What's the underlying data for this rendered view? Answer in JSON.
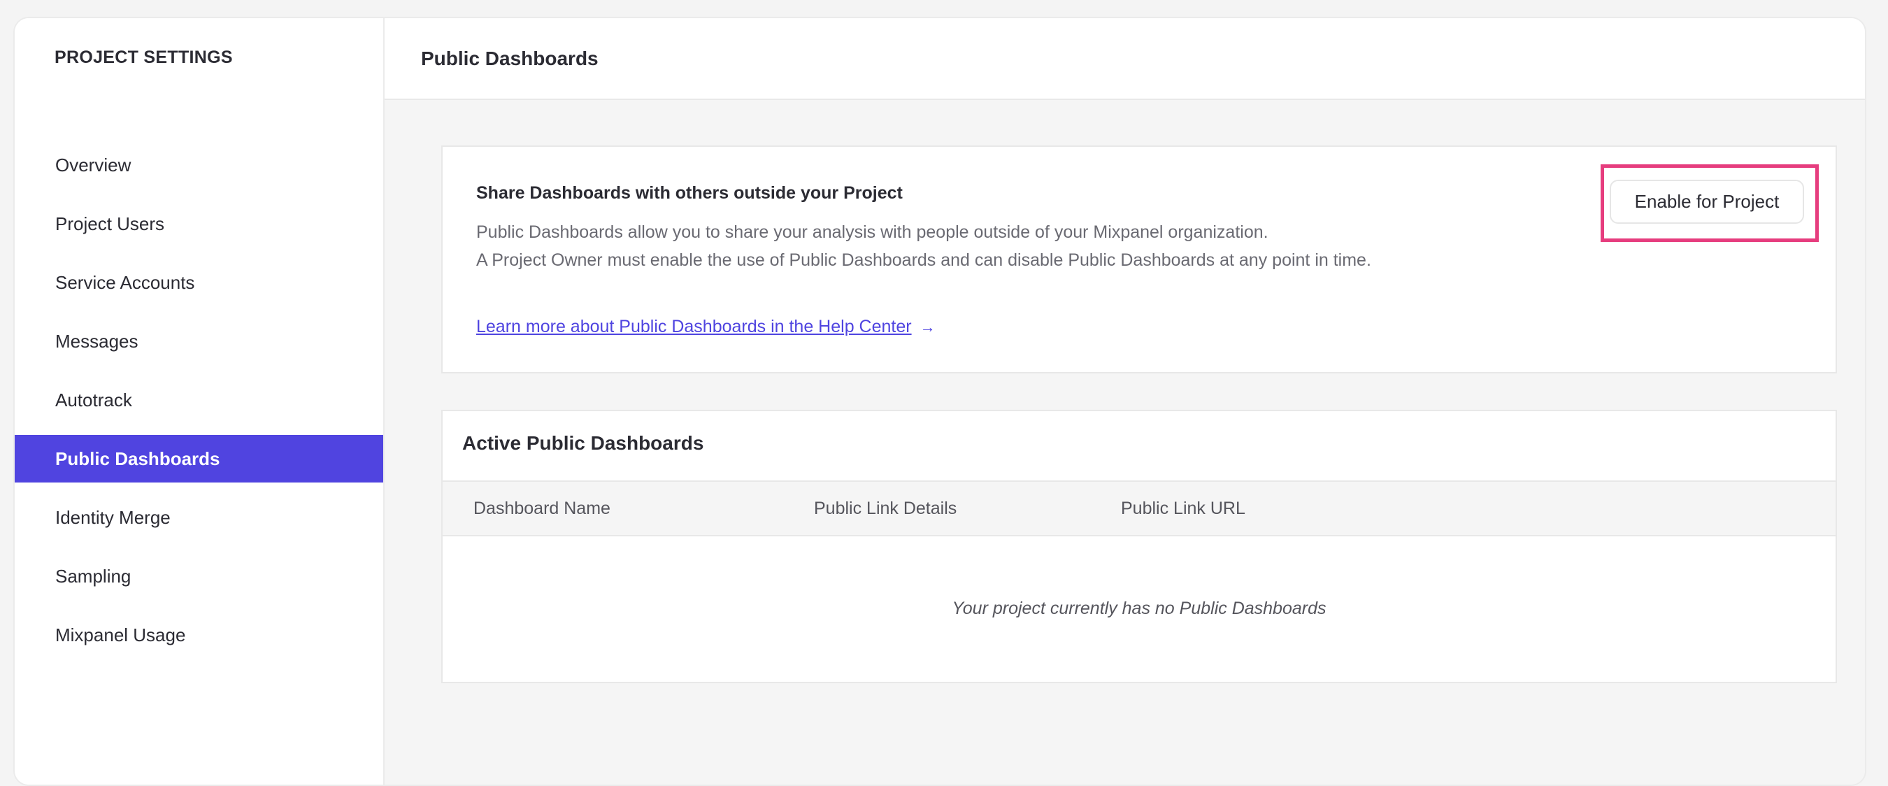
{
  "sidebar": {
    "title": "PROJECT SETTINGS",
    "items": [
      {
        "label": "Overview"
      },
      {
        "label": "Project Users"
      },
      {
        "label": "Service Accounts"
      },
      {
        "label": "Messages"
      },
      {
        "label": "Autotrack"
      },
      {
        "label": "Public Dashboards",
        "active": true
      },
      {
        "label": "Identity Merge"
      },
      {
        "label": "Sampling"
      },
      {
        "label": "Mixpanel Usage"
      }
    ]
  },
  "header": {
    "title": "Public Dashboards"
  },
  "share_card": {
    "title": "Share Dashboards with others outside your Project",
    "line1": "Public Dashboards allow you to share your analysis with people outside of your Mixpanel organization.",
    "line2": "A Project Owner must enable the use of Public Dashboards and can disable Public Dashboards at any point in time.",
    "link": "Learn more about Public Dashboards in the Help Center",
    "link_arrow": "→",
    "button": "Enable for Project"
  },
  "active_card": {
    "title": "Active Public Dashboards",
    "columns": [
      "Dashboard Name",
      "Public Link Details",
      "Public Link URL"
    ],
    "empty": "Your project currently has no Public Dashboards"
  },
  "colors": {
    "accent": "#5044e0",
    "highlight": "#e63d7e",
    "link": "#4f44e0"
  }
}
